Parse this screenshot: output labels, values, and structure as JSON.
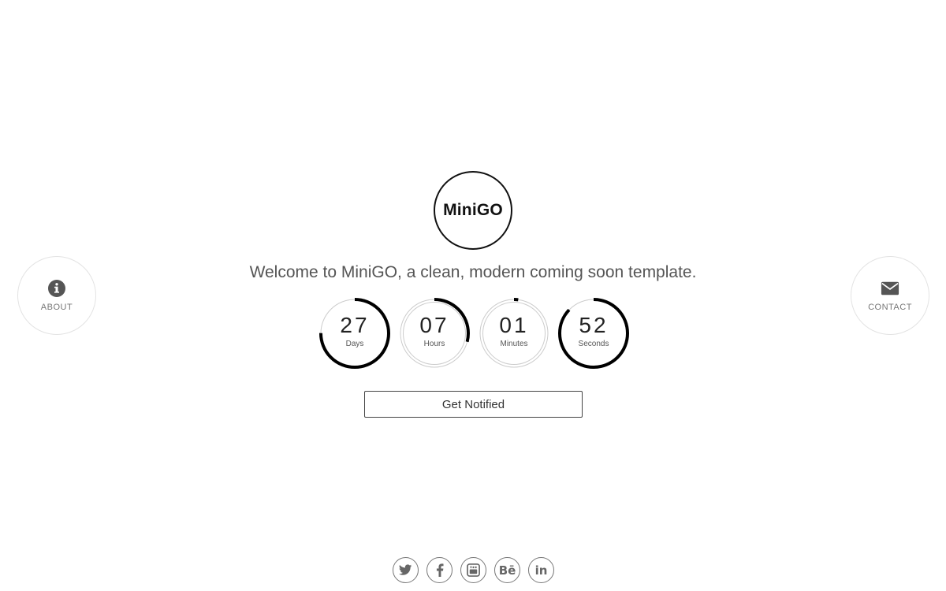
{
  "nav": {
    "about": {
      "label": "ABOUT",
      "icon": "info-icon"
    },
    "contact": {
      "label": "CONTACT",
      "icon": "envelope-icon"
    }
  },
  "logo": {
    "text": "MiniGO"
  },
  "tagline": "Welcome to MiniGO, a clean, modern coming soon template.",
  "countdown": [
    {
      "value": "27",
      "label": "Days",
      "progress": 0.75
    },
    {
      "value": "07",
      "label": "Hours",
      "progress": 0.29
    },
    {
      "value": "01",
      "label": "Minutes",
      "progress": 0.02
    },
    {
      "value": "52",
      "label": "Seconds",
      "progress": 0.87
    }
  ],
  "notify_button": {
    "label": "Get Notified"
  },
  "social": [
    {
      "name": "twitter",
      "icon": "twitter-icon"
    },
    {
      "name": "facebook",
      "icon": "facebook-icon"
    },
    {
      "name": "youtube",
      "icon": "youtube-icon"
    },
    {
      "name": "behance",
      "icon": "behance-icon",
      "text": "Bē"
    },
    {
      "name": "linkedin",
      "icon": "linkedin-icon",
      "text": "in"
    }
  ],
  "colors": {
    "ring_track": "#cccccc",
    "ring_progress": "#000000",
    "text_main": "#222222",
    "text_muted": "#777777"
  }
}
